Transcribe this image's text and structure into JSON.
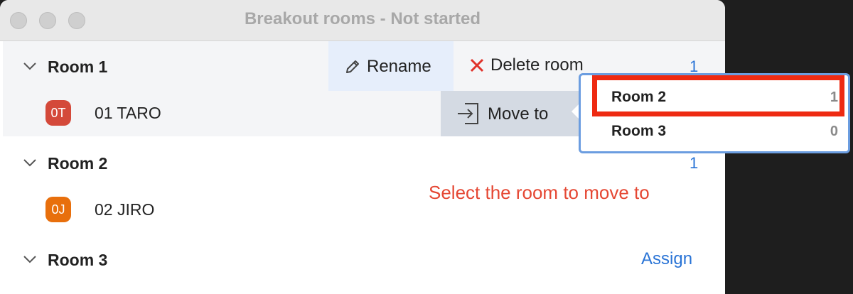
{
  "window": {
    "title": "Breakout rooms - Not started"
  },
  "rooms": [
    {
      "name": "Room 1",
      "count": "1",
      "participant": {
        "initials": "0T",
        "name": "01 TARO",
        "color": "#d4493a"
      }
    },
    {
      "name": "Room 2",
      "count": "1",
      "participant": {
        "initials": "0J",
        "name": "02 JIRO",
        "color": "#e86f0c"
      }
    },
    {
      "name": "Room 3",
      "action": "Assign"
    }
  ],
  "room_actions": {
    "rename": "Rename",
    "delete": "Delete room",
    "move_to": "Move to"
  },
  "move_menu": [
    {
      "label": "Room 2",
      "count": "1",
      "highlighted": true
    },
    {
      "label": "Room 3",
      "count": "0"
    }
  ],
  "annotation": "Select the room to move to",
  "colors": {
    "accent": "#2a74d6",
    "annotation": "#e54733",
    "highlight": "#ee2a12",
    "delete_icon": "#e0332b"
  }
}
